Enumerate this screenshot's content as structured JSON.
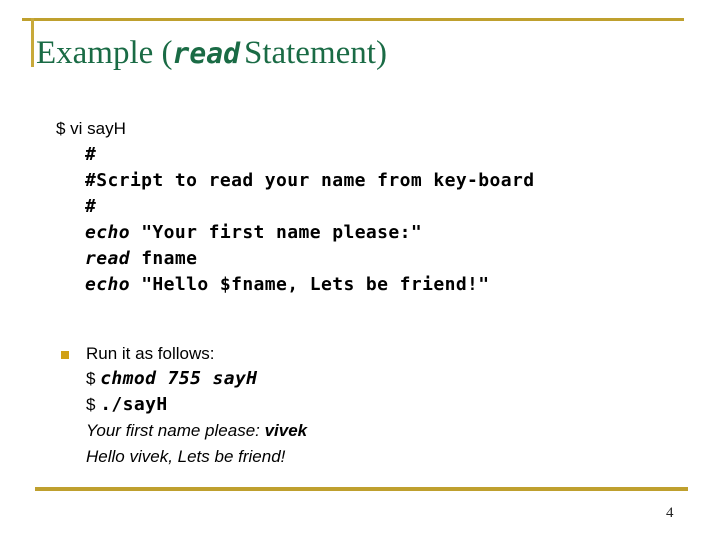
{
  "slide": {
    "page_number": "4",
    "accent_color": "#BFA02E",
    "title_color": "#1A6B45",
    "bullet_color": "#D0A016",
    "background_color": "#FFFFFF"
  },
  "title": {
    "prefix": "Example (",
    "keyword": "read",
    "suffix": "Statement",
    "closing": ")"
  },
  "code_block": {
    "prompt_line": "$ vi sayH",
    "lines": [
      {
        "text": "#",
        "style": "mono"
      },
      {
        "text": "#Script to read your name from key-board",
        "style": "mono"
      },
      {
        "text": "#",
        "style": "mono"
      },
      {
        "keyword": "echo",
        "rest": " \"Your first name please:\"",
        "style": "mono-italic-keyword"
      },
      {
        "keyword": "read",
        "rest": " fname",
        "style": "mono-italic-keyword"
      },
      {
        "keyword": "echo",
        "rest": " \"Hello $fname, Lets be friend!\"",
        "style": "mono-italic-keyword"
      }
    ]
  },
  "bullet": {
    "marker": "square-bullet",
    "heading": "Run it as follows:",
    "command_1_prompt": "$ ",
    "command_1": "chmod 755 sayH",
    "command_2_prompt": "$ ",
    "command_2": "./sayH",
    "output_1_text": "Your first name please: ",
    "output_1_input": "vivek",
    "output_2": "Hello vivek, Lets be friend!"
  }
}
